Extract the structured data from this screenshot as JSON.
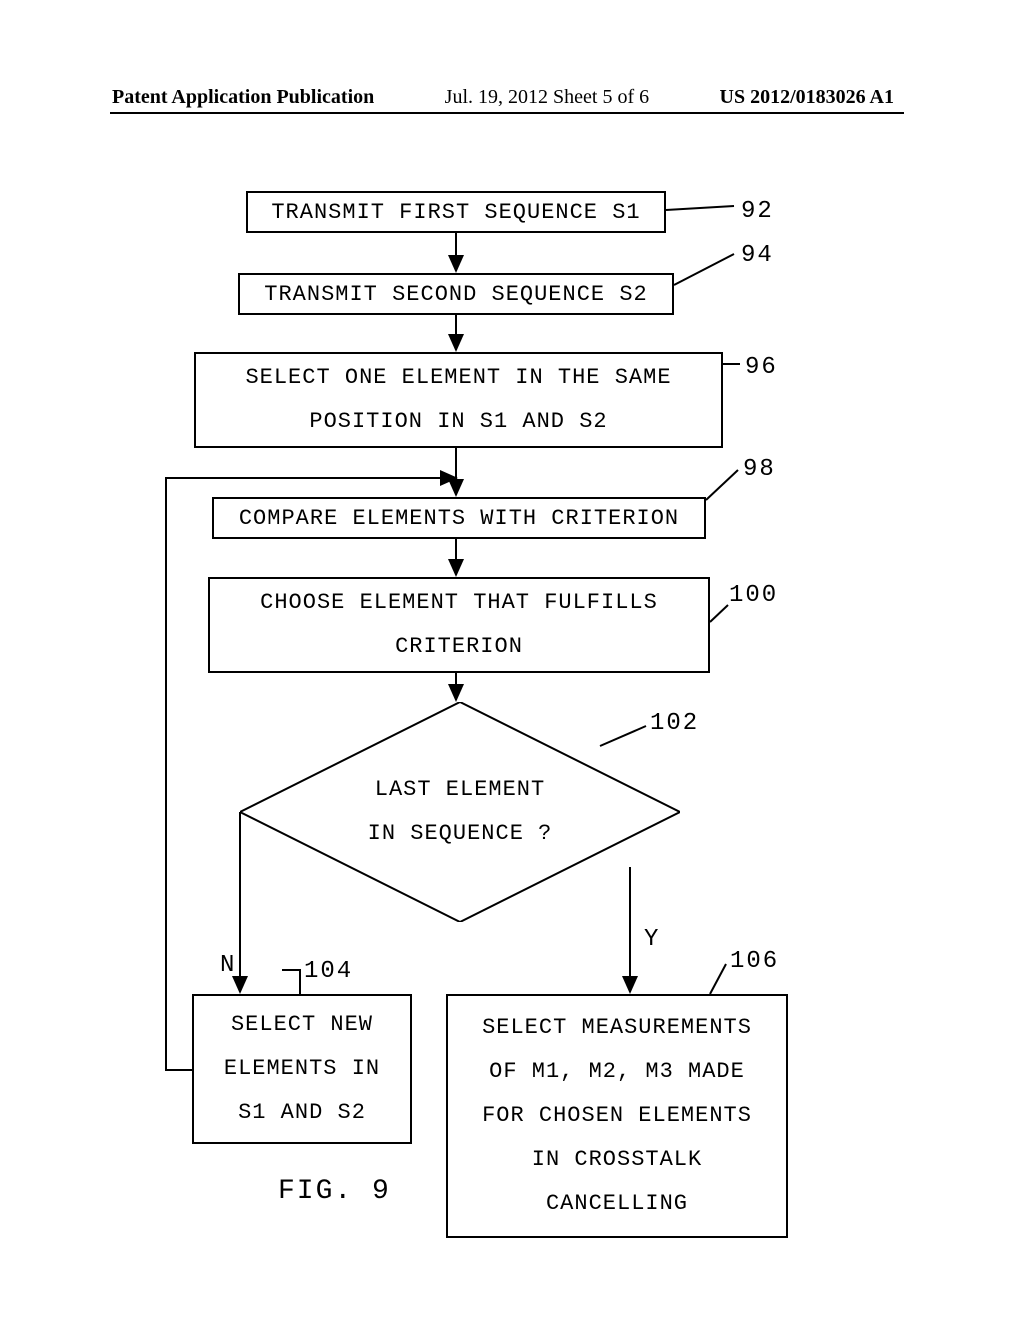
{
  "header": {
    "left": "Patent Application Publication",
    "mid": "Jul. 19, 2012  Sheet 5 of 6",
    "right": "US 2012/0183026 A1"
  },
  "blocks": {
    "b92": "TRANSMIT FIRST SEQUENCE S1",
    "b94": "TRANSMIT SECOND SEQUENCE S2",
    "b96": {
      "l1": "SELECT ONE ELEMENT IN THE SAME",
      "l2": "POSITION IN S1 AND S2"
    },
    "b98": "COMPARE ELEMENTS WITH CRITERION",
    "b100": {
      "l1": "CHOOSE ELEMENT THAT FULFILLS",
      "l2": "CRITERION"
    },
    "d102": {
      "l1": "LAST ELEMENT",
      "l2": "IN SEQUENCE ?"
    },
    "b104": {
      "l1": "SELECT NEW",
      "l2": "ELEMENTS IN",
      "l3": "S1 AND S2"
    },
    "b106": {
      "l1": "SELECT MEASUREMENTS",
      "l2": "OF M1, M2, M3 MADE",
      "l3": "FOR CHOSEN ELEMENTS",
      "l4": "IN CROSSTALK",
      "l5": "CANCELLING"
    }
  },
  "refs": {
    "r92": "92",
    "r94": "94",
    "r96": "96",
    "r98": "98",
    "r100": "100",
    "r102": "102",
    "r104": "104",
    "r106": "106"
  },
  "branches": {
    "no": "N",
    "yes": "Y"
  },
  "figure": "FIG. 9"
}
